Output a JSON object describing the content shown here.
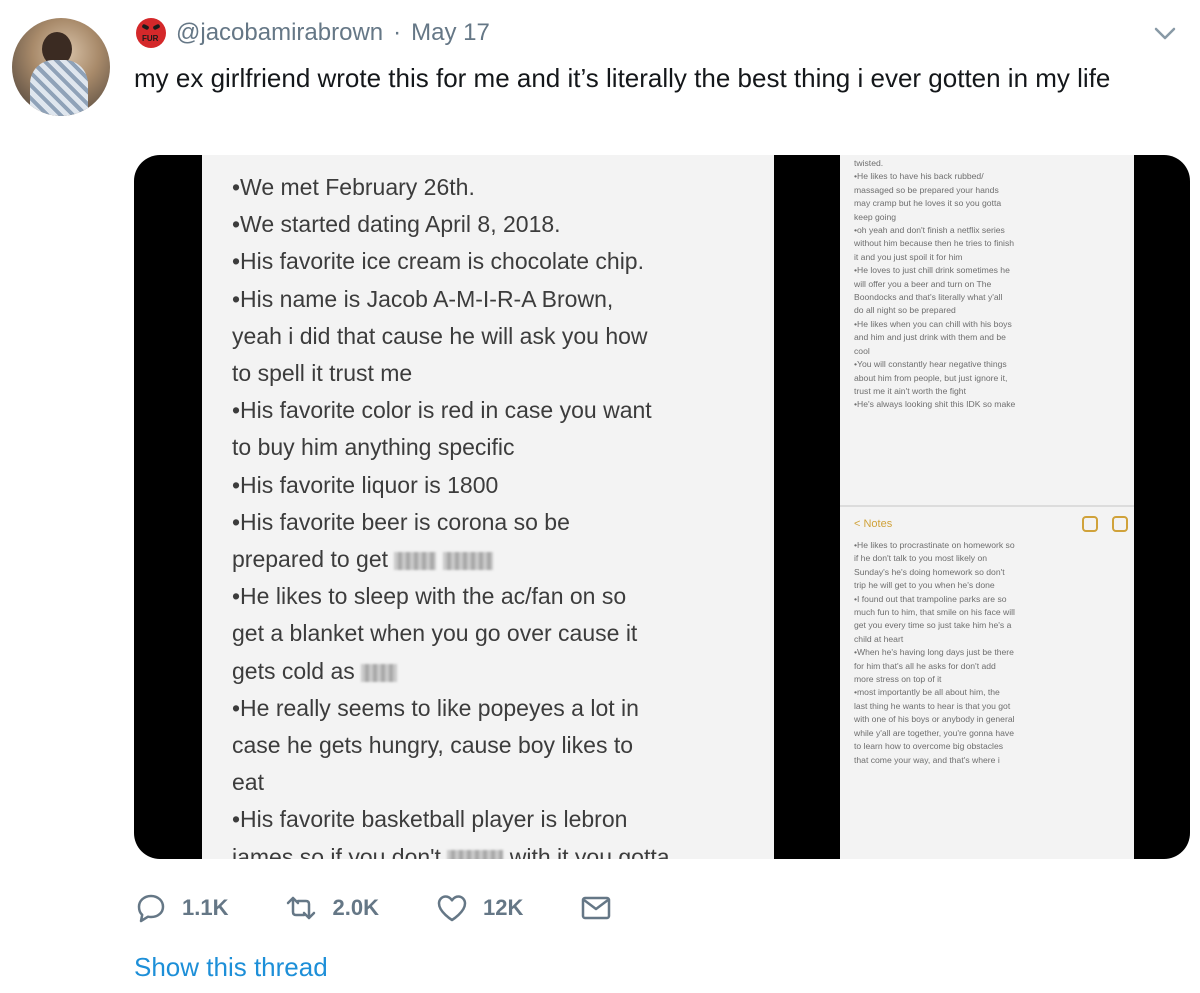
{
  "tweet": {
    "handle": "@jacobamirabrown",
    "separator": "·",
    "date": "May 17",
    "text": "my ex girlfriend wrote this for me and it’s literally the best thing i ever gotten in my life",
    "badge_text": "FUR",
    "avatar_icon": "profile-photo",
    "menu_icon": "chevron-down-icon"
  },
  "media": {
    "left_notes": [
      "•We met February 26th.",
      "•We started dating April 8, 2018.",
      "•His favorite ice cream is chocolate chip.",
      "•His name is Jacob A-M-I-R-A Brown,",
      "yeah i did that cause he will ask you how",
      "to spell it trust me",
      "•His favorite color is red in case you want",
      "to buy him anything specific",
      "•His favorite liquor is 1800",
      "•His favorite beer is corona so be",
      "prepared to get",
      "•He likes to sleep with the ac/fan on so",
      "get a blanket when you go over cause it",
      "gets cold as",
      "•He really seems to like popeyes a lot in",
      "case he gets hungry, cause boy likes to",
      "eat",
      "•His favorite basketball player is lebron",
      "james so if you don't",
      "with it you gotta"
    ],
    "right_top_notes": [
      "twisted.",
      "•He likes to have his back rubbed/",
      "massaged so be prepared your hands",
      "may cramp but he loves it so you gotta",
      "keep going",
      "•oh yeah and don't finish a netflix series",
      "without him because then he tries to finish",
      "it and you just spoil it for him",
      "•He loves to just chill drink sometimes he",
      "will offer you a beer and turn on The",
      "Boondocks and that's literally what y'all",
      "do all night so be prepared",
      "•He likes when you can chill with his boys",
      "and him and just drink with them and be",
      "cool",
      "•You will constantly hear negative things",
      "about him from people, but just ignore it,",
      "trust me it ain't worth the fight",
      "•He's always looking shit this IDK so make"
    ],
    "right_notes_back": "< Notes",
    "right_bottom_notes": [
      "•He likes to procrastinate on homework so",
      "if he don't talk to you most likely on",
      "Sunday's he's doing homework so don't",
      "trip he will get to you when he's done",
      "•I found out that trampoline parks are so",
      "much fun to him, that smile on his face will",
      "get you every time so just take him he's a",
      "child at heart",
      "•When he's having long days just be there",
      "for him that's all he asks for don't add",
      "more stress on top of it",
      "•most importantly be all about him, the",
      "last thing he wants to hear is that you got",
      "with one of his boys or anybody in general",
      "while y'all are together, you're gonna have",
      "to learn how to overcome big obstacles",
      "that come your way, and that's where i"
    ]
  },
  "actions": {
    "reply": {
      "icon": "reply-icon",
      "count": "1.1K"
    },
    "retweet": {
      "icon": "retweet-icon",
      "count": "2.0K"
    },
    "like": {
      "icon": "heart-icon",
      "count": "12K"
    },
    "dm": {
      "icon": "envelope-icon"
    }
  },
  "show_thread": "Show this thread",
  "colors": {
    "link": "#1d8fd8",
    "muted": "#657786",
    "text": "#14171a"
  }
}
